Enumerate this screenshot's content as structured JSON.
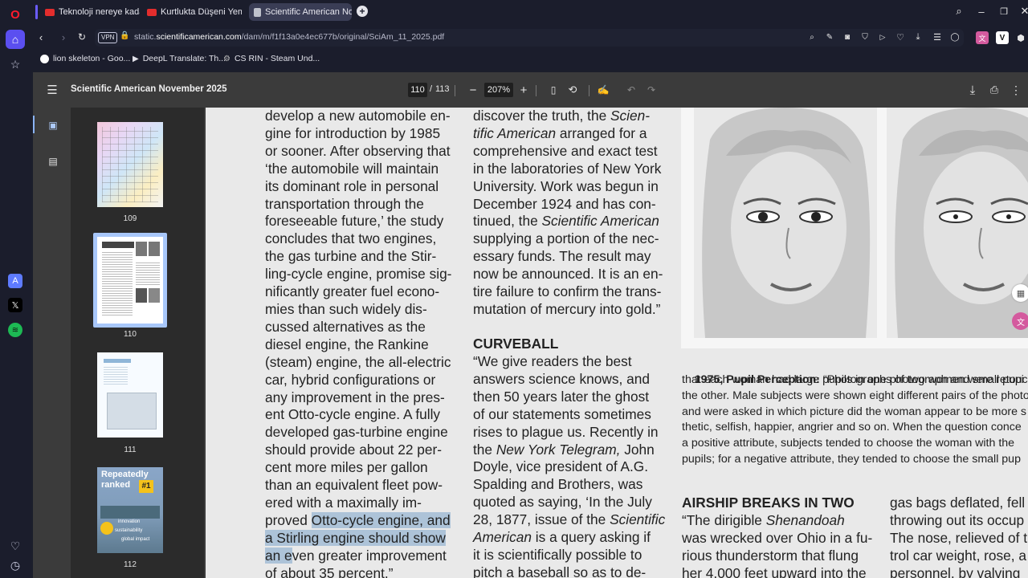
{
  "browser": {
    "tabs": [
      {
        "label": "Teknoloji nereye kadar ge",
        "favicon_color": "#e32d2d"
      },
      {
        "label": "Kurtlukta Düşeni Yemek K",
        "favicon_color": "#e32d2d"
      },
      {
        "label": "Scientific American Nover",
        "favicon_color": "#bfc2cc",
        "active": true
      }
    ],
    "url_prefix": "static.",
    "url_domain": "scientificamerican.com",
    "url_path": "/dam/m/f1f13a0e4ec677b/original/SciAm_11_2025.pdf",
    "vpn_label": "VPN",
    "bookmarks": [
      {
        "label": "lion skeleton - Goo..."
      },
      {
        "label": "DeepL Translate: Th..."
      },
      {
        "label": "CS RIN - Steam Und..."
      }
    ]
  },
  "pdf": {
    "title": "Scientific American November 2025",
    "current_page": "110",
    "page_sep": "/",
    "total_pages": "113",
    "zoom": "207%",
    "thumbnails": [
      {
        "page": "109"
      },
      {
        "page": "110",
        "selected": true
      },
      {
        "page": "111"
      },
      {
        "page": "112"
      }
    ],
    "thumb_text_112": [
      "Repeatedly",
      "ranked",
      "#1",
      "innovation",
      "sustainability",
      "global impact"
    ]
  },
  "page": {
    "col1": [
      "develop a new automobile en-",
      "gine for introduction by 1985",
      "or sooner. After observing that",
      "‘the automobile will maintain",
      "its dominant role in personal",
      "transportation through the",
      "foreseeable future,’ the study",
      "concludes that two engines,",
      "the gas turbine and the Stir-",
      "ling-cycle engine, promise sig-",
      "nificantly greater fuel econo-",
      "mies than such widely dis-",
      "cussed alternatives as the",
      "diesel engine, the Rankine",
      "(steam) engine, the all-electric",
      "car, hybrid configurations or",
      "any improvement in the pres-",
      "ent Otto-cycle engine. A fully",
      "developed gas-turbine engine",
      "should provide about 22 per-",
      "cent more miles per gallon",
      "than an equivalent fleet pow-",
      "ered with a maximally im-"
    ],
    "col1_hl_prefix": "proved ",
    "col1_hl_1": "Otto-cycle engine, and",
    "col1_hl_2": "a Stirling engine should show",
    "col1_hl_3a": "an e",
    "col1_hl_3b": "ven greater improvement",
    "col1_last": "of about 35 percent.”",
    "col2": [
      {
        "t": "discover the truth, the ",
        "i": "Scien-"
      },
      {
        "i": "tific American",
        "t": " arranged for a"
      },
      {
        "t": "comprehensive and exact test"
      },
      {
        "t": "in the laboratories of New York"
      },
      {
        "t": "University. Work was begun in"
      },
      {
        "t": "December 1924 and has con-"
      },
      {
        "t": "tinued, the ",
        "i": "Scientific American"
      },
      {
        "t": "supplying a portion of the nec-"
      },
      {
        "t": "essary funds. The result may"
      },
      {
        "t": "now be announced. It is an en-"
      },
      {
        "t": "tire failure to confirm the trans-"
      },
      {
        "t": "mutation of mercury into gold.”"
      }
    ],
    "curveball_heading": "CURVEBALL",
    "col2b": [
      {
        "t": "“We give readers the best"
      },
      {
        "t": "answers science knows, and"
      },
      {
        "t": "then 50 years later the ghost"
      },
      {
        "t": "of our statements sometimes"
      },
      {
        "t": "rises to plague us. Recently in"
      },
      {
        "t": "the ",
        "i": "New York Telegram,",
        "t2": " John"
      },
      {
        "t": "Doyle, vice president of A.G."
      },
      {
        "t": "Spalding and Brothers, was"
      },
      {
        "t": "quoted as saying, ‘In the July"
      },
      {
        "t": "28, 1877, issue of the ",
        "i": "Scientific"
      },
      {
        "i": "American",
        "t": " is a query asking if"
      },
      {
        "t": "it is scientifically possible to"
      },
      {
        "t": "pitch a baseball so as to de-"
      }
    ],
    "caption_bold": "1975, Pupil Perception:",
    "caption_lines": [
      " “Photographs of two women were retouch",
      "that each woman had large pupils in one photograph and small pupi",
      "the other. Male subjects were shown eight different pairs of the photo",
      "and were asked in which picture did the woman appear to be more s",
      "thetic, selfish, happier, angrier and so on. When the question conce",
      "a positive attribute, subjects tended to choose the woman with the",
      "pupils; for a negative attribute, they tended to choose the small pup"
    ],
    "airship_heading": "AIRSHIP BREAKS IN TWO",
    "airship_lines": [
      {
        "t": "“The dirigible ",
        "i": "Shenandoah"
      },
      {
        "t": "was wrecked over Ohio in a fu-"
      },
      {
        "t": "rious thunderstorm that flung"
      },
      {
        "t": "her 4,000 feet upward into the"
      }
    ],
    "col4_lines": [
      "gas bags deflated, fell",
      "throwing out its occup",
      "The nose, relieved of t",
      "trol car weight, rose, a",
      "personnel, by valving"
    ]
  }
}
